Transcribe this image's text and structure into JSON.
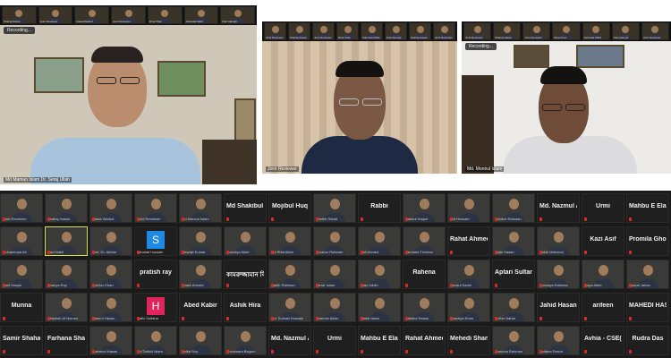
{
  "recording_label": "Recording...",
  "panels": {
    "left": {
      "speaker_name": "Md Mamun Islam Dr. Seraj Ullah"
    },
    "center": {
      "speaker_name": "Joint Reviewer"
    },
    "right": {
      "speaker_name": "Md. Monirul Islam"
    }
  },
  "top_strip_left": [
    "Shahaj Hasan",
    "Joint Reviewer",
    "Faisal Wadud",
    "Joint Reviewer",
    "Rina Khan",
    "Fahmida Mafiz",
    "Kazi Alamgir"
  ],
  "top_strip_center": [
    "Joint Reviewer",
    "Shahaj Hasan",
    "Joint Reviewer",
    "Rina Khan",
    "Fahmida Mafiz",
    "Kazi Alamgir",
    "Shahaj Hasan",
    "Joint Reviewer"
  ],
  "top_strip_right": [
    "Joint Reviewer",
    "Shahaj Hasan",
    "Joint Reviewer",
    "Rina Khan",
    "Fahmida Mafiz",
    "Kazi Alamgir",
    "Joint Reviewer"
  ],
  "gallery": [
    [
      {
        "kind": "video",
        "label": "Joint Reviewer"
      },
      {
        "kind": "video",
        "label": "Shahaj Hasan"
      },
      {
        "kind": "video",
        "label": "Faisal Wadud"
      },
      {
        "kind": "video",
        "label": "Joint Reviewer"
      },
      {
        "kind": "video",
        "label": "Md Mamun Islam"
      },
      {
        "kind": "name",
        "label": "Md Shakibul Isl..."
      },
      {
        "kind": "name",
        "label": "Mojibul Huq"
      },
      {
        "kind": "video",
        "label": "Sheikh Rahat"
      },
      {
        "kind": "name",
        "label": "Rabbi"
      },
      {
        "kind": "video",
        "label": "Naimul Haque"
      },
      {
        "kind": "video",
        "label": "Arif Hossain"
      },
      {
        "kind": "video",
        "label": "Ashikur Rahman"
      },
      {
        "kind": "name",
        "label": "Md. Nazmul Ab..."
      },
      {
        "kind": "name",
        "label": "Urmi"
      },
      {
        "kind": "name",
        "label": "Mahbu E Elahi"
      }
    ],
    [
      {
        "kind": "video",
        "label": "Mohammad Ali"
      },
      {
        "kind": "video",
        "label": "Kazi Nabil",
        "active": true
      },
      {
        "kind": "video",
        "label": "Prof. Dr. Akhtar"
      },
      {
        "kind": "avatar",
        "label": "sahadat hossain",
        "letter": "S",
        "color": "#1e88e5"
      },
      {
        "kind": "video",
        "label": "Biswajit Kumar"
      },
      {
        "kind": "video",
        "label": "Sumaiya Akter"
      },
      {
        "kind": "video",
        "label": "Md Rifat Alam"
      },
      {
        "kind": "video",
        "label": "Mizanur Rahman"
      },
      {
        "kind": "video",
        "label": "Asif Ahmed"
      },
      {
        "kind": "video",
        "label": "Jannatul Ferdous"
      },
      {
        "kind": "name",
        "label": "Rahat Ahmed (..."
      },
      {
        "kind": "video",
        "label": "Sajib Hasan"
      },
      {
        "kind": "video",
        "label": "Sakib Mahmud"
      },
      {
        "kind": "name",
        "label": "Kazi Asif"
      },
      {
        "kind": "name",
        "label": "Promila Ghosh"
      }
    ],
    [
      {
        "kind": "video",
        "label": "Sarif Haque"
      },
      {
        "kind": "video",
        "label": "Ananya Roy"
      },
      {
        "kind": "video",
        "label": "Mahfuz Khan"
      },
      {
        "kind": "name",
        "label": "pratish ray"
      },
      {
        "kind": "video",
        "label": "Shakil Ahmed"
      },
      {
        "kind": "name",
        "label": "কামরুজ্জামান বিশ্বাস"
      },
      {
        "kind": "video",
        "label": "Habib Rahman"
      },
      {
        "kind": "video",
        "label": "Tanvir Islam"
      },
      {
        "kind": "video",
        "label": "Riaz Uddin"
      },
      {
        "kind": "name",
        "label": "Rahena"
      },
      {
        "kind": "video",
        "label": "Rezaul Karim"
      },
      {
        "kind": "name",
        "label": "Aptari Sultana (..."
      },
      {
        "kind": "video",
        "label": "Sumaiya Rahman"
      },
      {
        "kind": "video",
        "label": "Rupa Akter"
      },
      {
        "kind": "video",
        "label": "Nusrat Jahan"
      }
    ],
    [
      {
        "kind": "name",
        "label": "Munna"
      },
      {
        "kind": "video",
        "label": "Abdullah Al Noman"
      },
      {
        "kind": "video",
        "label": "Kamrul Hasan"
      },
      {
        "kind": "avatar",
        "label": "Hafiz Sultana",
        "letter": "H",
        "color": "#e0245e"
      },
      {
        "kind": "name",
        "label": "Abed Kabir"
      },
      {
        "kind": "name",
        "label": "Ashik Hira"
      },
      {
        "kind": "video",
        "label": "Md. Sohrab Hossain"
      },
      {
        "kind": "video",
        "label": "Sharmin Akter"
      },
      {
        "kind": "video",
        "label": "Sadia Islam"
      },
      {
        "kind": "video",
        "label": "Rakibul Hasan"
      },
      {
        "kind": "video",
        "label": "Sumaiya Khan"
      },
      {
        "kind": "video",
        "label": "Lutfun Nahar"
      },
      {
        "kind": "name",
        "label": "Jahid Hasan"
      },
      {
        "kind": "name",
        "label": "arifeen"
      },
      {
        "kind": "name",
        "label": "MAHEDI HASS..."
      }
    ],
    [
      {
        "kind": "name",
        "label": "Samir Shaharior"
      },
      {
        "kind": "name",
        "label": "Farhana Sharmi..."
      },
      {
        "kind": "video",
        "label": "Mahmud Hasan"
      },
      {
        "kind": "video",
        "label": "Md Tarikul Islam"
      },
      {
        "kind": "video",
        "label": "Anika Roy"
      },
      {
        "kind": "video",
        "label": "Monowara Begum"
      },
      {
        "kind": "name",
        "label": "Md. Nazmul Ab..."
      },
      {
        "kind": "name",
        "label": "Urmi"
      },
      {
        "kind": "name",
        "label": "Mahbu E Elahi"
      },
      {
        "kind": "name",
        "label": "Rahat Ahmed (..."
      },
      {
        "kind": "name",
        "label": "Mehedi Shanto"
      },
      {
        "kind": "video",
        "label": "Sumona Rahman"
      },
      {
        "kind": "video",
        "label": "Sultana Parvin"
      },
      {
        "kind": "name",
        "label": "Avhia - CSE(BA)"
      },
      {
        "kind": "name",
        "label": "Rudra Das"
      }
    ]
  ]
}
